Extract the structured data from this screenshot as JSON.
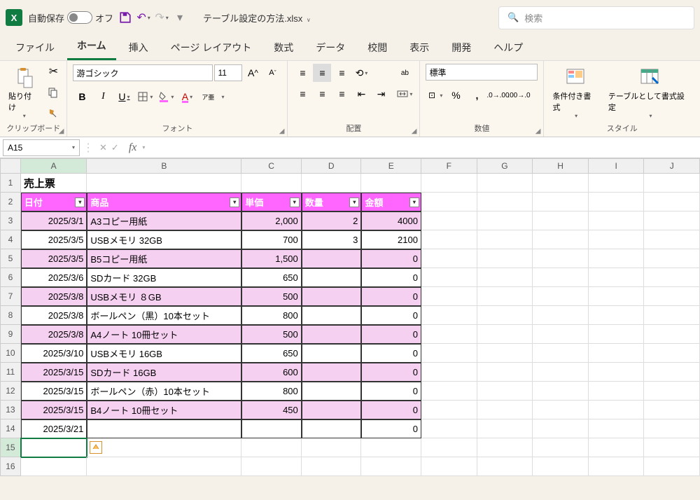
{
  "app": {
    "autosave_label": "自動保存",
    "autosave_state": "オフ",
    "filename": "テーブル設定の方法.xlsx",
    "search_placeholder": "検索"
  },
  "tabs": [
    "ファイル",
    "ホーム",
    "挿入",
    "ページ レイアウト",
    "数式",
    "データ",
    "校閲",
    "表示",
    "開発",
    "ヘルプ"
  ],
  "active_tab": 1,
  "ribbon": {
    "clipboard": {
      "label": "クリップボード",
      "paste": "貼り付け"
    },
    "font": {
      "label": "フォント",
      "name": "游ゴシック",
      "size": "11",
      "phonetic": "ア亜"
    },
    "align": {
      "label": "配置",
      "wrap": "ab"
    },
    "number": {
      "label": "数値",
      "format": "標準"
    },
    "styles": {
      "label": "スタイル",
      "cond": "条件付き書式",
      "table": "テーブルとして書式設定"
    }
  },
  "namebox": "A15",
  "columns": [
    "A",
    "B",
    "C",
    "D",
    "E",
    "F",
    "G",
    "H",
    "I",
    "J"
  ],
  "row_count": 16,
  "title_cell": "売上票",
  "headers": [
    "日付",
    "商品",
    "単価",
    "数量",
    "金額"
  ],
  "rows": [
    [
      "2025/3/1",
      "A3コピー用紙",
      "2,000",
      "2",
      "4000"
    ],
    [
      "2025/3/5",
      "USBメモリ 32GB",
      "700",
      "3",
      "2100"
    ],
    [
      "2025/3/5",
      "B5コピー用紙",
      "1,500",
      "",
      "0"
    ],
    [
      "2025/3/6",
      "SDカード 32GB",
      "650",
      "",
      "0"
    ],
    [
      "2025/3/8",
      "USBメモリ ８GB",
      "500",
      "",
      "0"
    ],
    [
      "2025/3/8",
      "ボールペン（黒）10本セット",
      "800",
      "",
      "0"
    ],
    [
      "2025/3/8",
      "A4ノート 10冊セット",
      "500",
      "",
      "0"
    ],
    [
      "2025/3/10",
      "USBメモリ 16GB",
      "650",
      "",
      "0"
    ],
    [
      "2025/3/15",
      "SDカード 16GB",
      "600",
      "",
      "0"
    ],
    [
      "2025/3/15",
      "ボールペン（赤）10本セット",
      "800",
      "",
      "0"
    ],
    [
      "2025/3/15",
      "B4ノート 10冊セット",
      "450",
      "",
      "0"
    ],
    [
      "2025/3/21",
      "",
      "",
      "",
      "0"
    ]
  ]
}
